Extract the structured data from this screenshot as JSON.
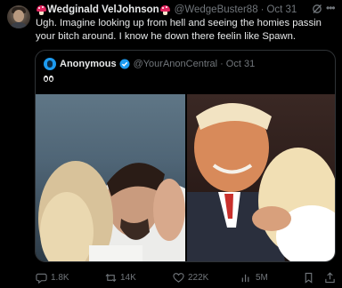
{
  "tweet": {
    "display_name": "Wedginald VelJohnson",
    "handle": "@WedgeBuster88",
    "separator": "·",
    "time": "Oct 31",
    "text": "Ugh. Imagine looking up from hell and seeing the homies passin your bitch around. I know he down there feelin like Spawn."
  },
  "quote": {
    "display_name": "Anonymous",
    "handle": "@YourAnonCentral",
    "separator": "·",
    "time": "Oct 31",
    "content_emoji": "eyes"
  },
  "actions": {
    "replies": "1.8K",
    "retweets": "14K",
    "likes": "222K",
    "views": "5M"
  },
  "colors": {
    "background": "#000000",
    "text": "#e7e9ea",
    "muted": "#71767b",
    "accent": "#1d9bf0",
    "border": "#2f3336"
  },
  "icons": [
    "more-icon",
    "grok-icon",
    "verified-badge-icon",
    "reply-icon",
    "retweet-icon",
    "like-icon",
    "views-icon",
    "bookmark-icon",
    "share-icon",
    "mushroom-emoji-icon",
    "eyes-emoji-icon"
  ]
}
